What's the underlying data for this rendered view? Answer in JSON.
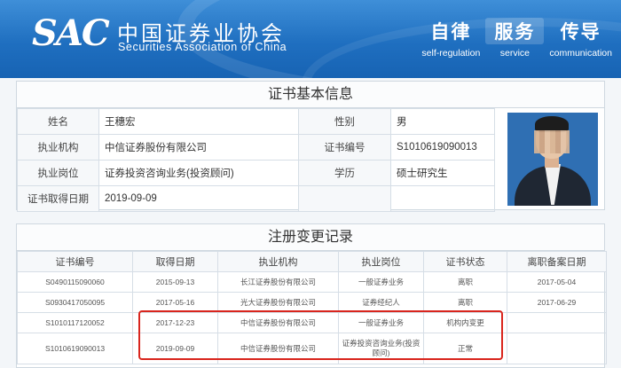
{
  "header": {
    "logo_mark": "SAC",
    "org_name_cn": "中国证券业协会",
    "org_name_en": "Securities Association of China",
    "mottos": [
      {
        "cn": "自律",
        "en": "self-regulation"
      },
      {
        "cn": "服务",
        "en": "service"
      },
      {
        "cn": "传导",
        "en": "communication"
      }
    ]
  },
  "basic_info": {
    "title": "证书基本信息",
    "rows": [
      {
        "l1": "姓名",
        "v1": "王穗宏",
        "l2": "性别",
        "v2": "男"
      },
      {
        "l1": "执业机构",
        "v1": "中信证券股份有限公司",
        "l2": "证书编号",
        "v2": "S1010619090013"
      },
      {
        "l1": "执业岗位",
        "v1": "证券投资咨询业务(投资顾问)",
        "l2": "学历",
        "v2": "硕士研究生"
      },
      {
        "l1": "证书取得日期",
        "v1": "2019-09-09",
        "l2": "",
        "v2": ""
      }
    ]
  },
  "records": {
    "title": "注册变更记录",
    "headers": [
      "证书编号",
      "取得日期",
      "执业机构",
      "执业岗位",
      "证书状态",
      "离职备案日期"
    ],
    "rows": [
      [
        "S0490115090060",
        "2015-09-13",
        "长江证券股份有限公司",
        "一般证券业务",
        "离职",
        "2017-05-04"
      ],
      [
        "S0930417050095",
        "2017-05-16",
        "光大证券股份有限公司",
        "证券经纪人",
        "离职",
        "2017-06-29"
      ],
      [
        "S1010117120052",
        "2017-12-23",
        "中信证券股份有限公司",
        "一般证券业务",
        "机构内变更",
        ""
      ],
      [
        "S1010619090013",
        "2019-09-09",
        "中信证券股份有限公司",
        "证券投资咨询业务(投资顾问)",
        "正常",
        ""
      ]
    ]
  },
  "colors": {
    "banner": "#1f6fc0",
    "highlight": "#d9251d"
  }
}
